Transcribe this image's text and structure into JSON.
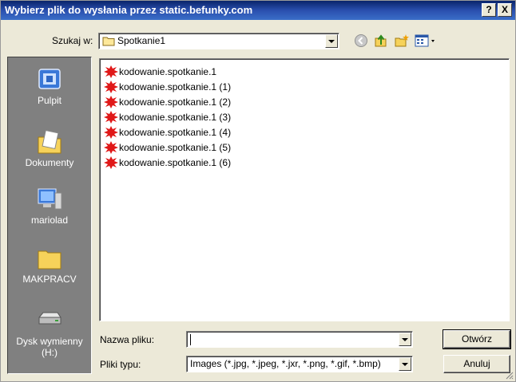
{
  "window": {
    "title": "Wybierz plik do wysłania przez static.befunky.com",
    "help_label": "?",
    "close_label": "X"
  },
  "lookin": {
    "label": "Szukaj w:",
    "value": "Spotkanie1"
  },
  "places": [
    {
      "label": "Pulpit",
      "icon": "desktop-icon"
    },
    {
      "label": "Dokumenty",
      "icon": "documents-icon"
    },
    {
      "label": "mariolad",
      "icon": "computer-icon"
    },
    {
      "label": "MAKPRACV",
      "icon": "folder-icon"
    },
    {
      "label": "Dysk wymienny (H:)",
      "icon": "removable-drive-icon"
    }
  ],
  "files": [
    "kodowanie.spotkanie.1",
    "kodowanie.spotkanie.1 (1)",
    "kodowanie.spotkanie.1 (2)",
    "kodowanie.spotkanie.1 (3)",
    "kodowanie.spotkanie.1 (4)",
    "kodowanie.spotkanie.1 (5)",
    "kodowanie.spotkanie.1 (6)"
  ],
  "filename": {
    "label": "Nazwa pliku:",
    "value": ""
  },
  "filetype": {
    "label": "Pliki typu:",
    "value": "Images (*.jpg, *.jpeg, *.jxr, *.png, *.gif, *.bmp)"
  },
  "buttons": {
    "open": "Otwórz",
    "cancel": "Anuluj"
  }
}
